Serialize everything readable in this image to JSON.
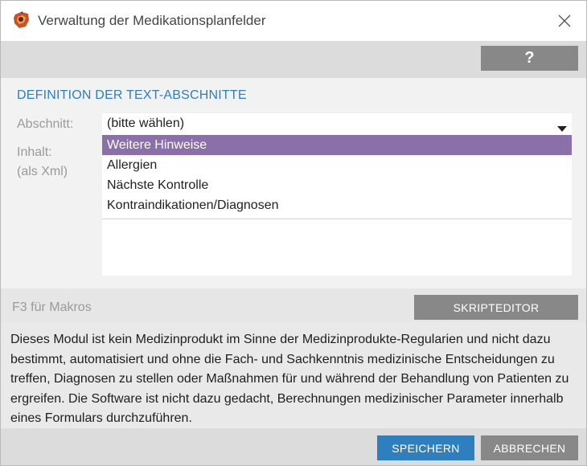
{
  "window": {
    "title": "Verwaltung der Medikationsplanfelder",
    "app_icon": "app-logo-icon",
    "close_icon": "close-icon"
  },
  "toolbar": {
    "help_label": "?"
  },
  "section": {
    "heading": "DEFINITION DER TEXT-ABSCHNITTE"
  },
  "form": {
    "abschnitt_label": "Abschnitt:",
    "inhalt_label": "Inhalt:",
    "inhalt_sublabel": "(als Xml)",
    "select": {
      "value": "(bitte wählen)",
      "options": [
        "Weitere Hinweise",
        "Allergien",
        "Nächste Kontrolle",
        "Kontraindikationen/Diagnosen"
      ],
      "highlighted_index": 0
    }
  },
  "macros": {
    "hint": "F3 für Makros",
    "script_editor_label": "SKRIPTEDITOR"
  },
  "disclaimer": {
    "text": "Dieses Modul ist kein Medizinprodukt im Sinne der Medizinprodukte-Regularien und nicht dazu bestimmt, automatisiert und ohne die Fach- und Sachkenntnis medizinische Entscheidungen zu treffen, Diagnosen zu stellen oder Maßnahmen für und während der Behandlung von Patienten zu ergreifen. Die Software ist nicht dazu gedacht, Berechnungen medizinischer Parameter innerhalb eines Formulars durchzuführen."
  },
  "footer": {
    "save_label": "SPEICHERN",
    "cancel_label": "ABBRECHEN"
  },
  "colors": {
    "accent_blue": "#2e7fbd",
    "highlight_purple": "#8a6fa8",
    "button_gray": "#888888"
  }
}
